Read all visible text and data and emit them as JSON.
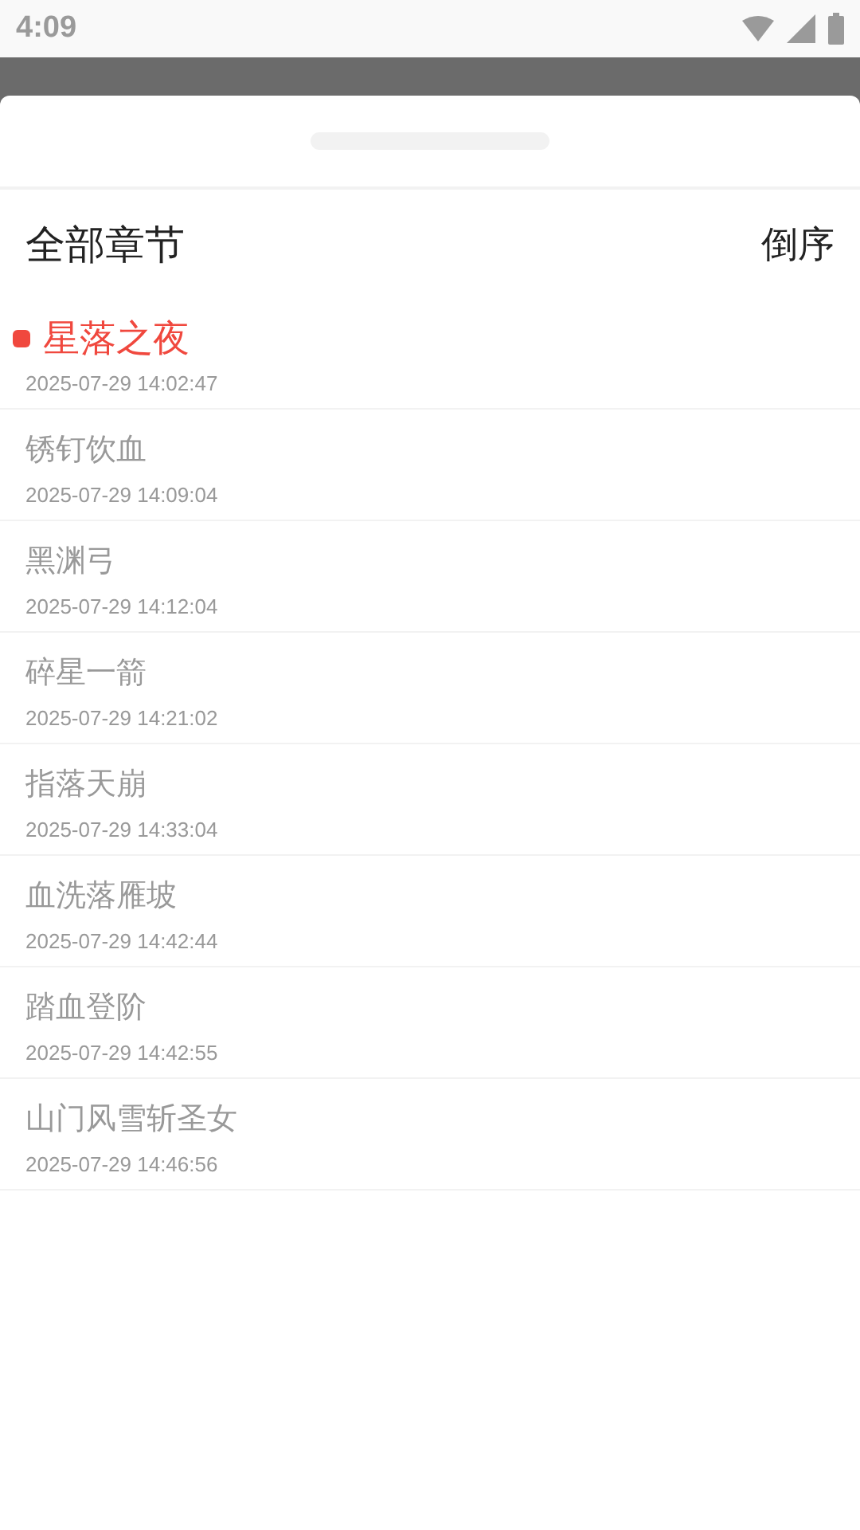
{
  "status_bar": {
    "time": "4:09"
  },
  "sheet": {
    "title": "全部章节",
    "sort_button": "倒序"
  },
  "chapters": [
    {
      "title": "星落之夜",
      "time": "2025-07-29 14:02:47",
      "selected": true
    },
    {
      "title": "锈钉饮血",
      "time": "2025-07-29 14:09:04",
      "selected": false
    },
    {
      "title": "黑渊弓",
      "time": "2025-07-29 14:12:04",
      "selected": false
    },
    {
      "title": "碎星一箭",
      "time": "2025-07-29 14:21:02",
      "selected": false
    },
    {
      "title": "指落天崩",
      "time": "2025-07-29 14:33:04",
      "selected": false
    },
    {
      "title": "血洗落雁坡",
      "time": "2025-07-29 14:42:44",
      "selected": false
    },
    {
      "title": "踏血登阶",
      "time": "2025-07-29 14:42:55",
      "selected": false
    },
    {
      "title": "山门风雪斩圣女",
      "time": "2025-07-29 14:46:56",
      "selected": false
    }
  ]
}
